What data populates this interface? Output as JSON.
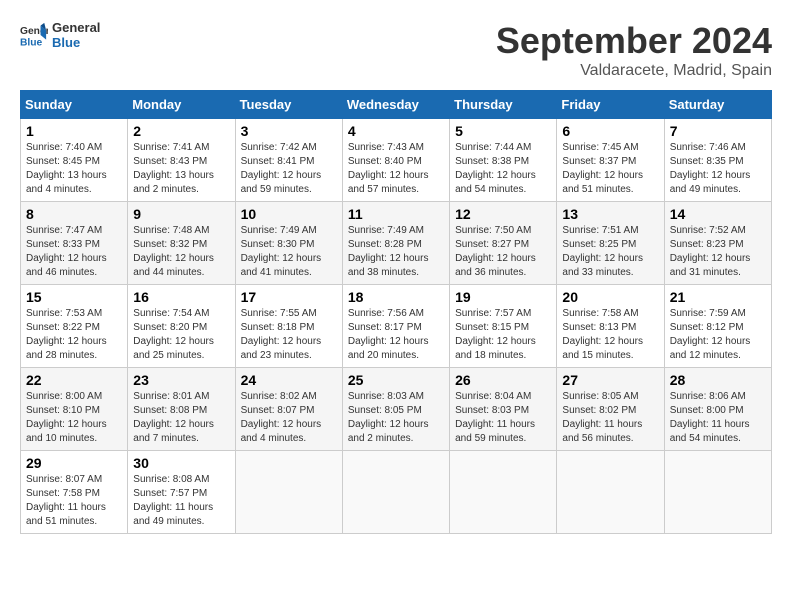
{
  "header": {
    "logo_text_general": "General",
    "logo_text_blue": "Blue",
    "title": "September 2024",
    "subtitle": "Valdaracete, Madrid, Spain"
  },
  "calendar": {
    "days_of_week": [
      "Sunday",
      "Monday",
      "Tuesday",
      "Wednesday",
      "Thursday",
      "Friday",
      "Saturday"
    ],
    "weeks": [
      [
        {
          "day": "",
          "info": ""
        },
        {
          "day": "",
          "info": ""
        },
        {
          "day": "",
          "info": ""
        },
        {
          "day": "",
          "info": ""
        },
        {
          "day": "5",
          "info": "Sunrise: 7:44 AM\nSunset: 8:38 PM\nDaylight: 12 hours and 54 minutes."
        },
        {
          "day": "6",
          "info": "Sunrise: 7:45 AM\nSunset: 8:37 PM\nDaylight: 12 hours and 51 minutes."
        },
        {
          "day": "7",
          "info": "Sunrise: 7:46 AM\nSunset: 8:35 PM\nDaylight: 12 hours and 49 minutes."
        }
      ],
      [
        {
          "day": "1",
          "info": "Sunrise: 7:40 AM\nSunset: 8:45 PM\nDaylight: 13 hours and 4 minutes."
        },
        {
          "day": "2",
          "info": "Sunrise: 7:41 AM\nSunset: 8:43 PM\nDaylight: 13 hours and 2 minutes."
        },
        {
          "day": "3",
          "info": "Sunrise: 7:42 AM\nSunset: 8:41 PM\nDaylight: 12 hours and 59 minutes."
        },
        {
          "day": "4",
          "info": "Sunrise: 7:43 AM\nSunset: 8:40 PM\nDaylight: 12 hours and 57 minutes."
        },
        {
          "day": "5",
          "info": "Sunrise: 7:44 AM\nSunset: 8:38 PM\nDaylight: 12 hours and 54 minutes."
        },
        {
          "day": "6",
          "info": "Sunrise: 7:45 AM\nSunset: 8:37 PM\nDaylight: 12 hours and 51 minutes."
        },
        {
          "day": "7",
          "info": "Sunrise: 7:46 AM\nSunset: 8:35 PM\nDaylight: 12 hours and 49 minutes."
        }
      ],
      [
        {
          "day": "8",
          "info": "Sunrise: 7:47 AM\nSunset: 8:33 PM\nDaylight: 12 hours and 46 minutes."
        },
        {
          "day": "9",
          "info": "Sunrise: 7:48 AM\nSunset: 8:32 PM\nDaylight: 12 hours and 44 minutes."
        },
        {
          "day": "10",
          "info": "Sunrise: 7:49 AM\nSunset: 8:30 PM\nDaylight: 12 hours and 41 minutes."
        },
        {
          "day": "11",
          "info": "Sunrise: 7:49 AM\nSunset: 8:28 PM\nDaylight: 12 hours and 38 minutes."
        },
        {
          "day": "12",
          "info": "Sunrise: 7:50 AM\nSunset: 8:27 PM\nDaylight: 12 hours and 36 minutes."
        },
        {
          "day": "13",
          "info": "Sunrise: 7:51 AM\nSunset: 8:25 PM\nDaylight: 12 hours and 33 minutes."
        },
        {
          "day": "14",
          "info": "Sunrise: 7:52 AM\nSunset: 8:23 PM\nDaylight: 12 hours and 31 minutes."
        }
      ],
      [
        {
          "day": "15",
          "info": "Sunrise: 7:53 AM\nSunset: 8:22 PM\nDaylight: 12 hours and 28 minutes."
        },
        {
          "day": "16",
          "info": "Sunrise: 7:54 AM\nSunset: 8:20 PM\nDaylight: 12 hours and 25 minutes."
        },
        {
          "day": "17",
          "info": "Sunrise: 7:55 AM\nSunset: 8:18 PM\nDaylight: 12 hours and 23 minutes."
        },
        {
          "day": "18",
          "info": "Sunrise: 7:56 AM\nSunset: 8:17 PM\nDaylight: 12 hours and 20 minutes."
        },
        {
          "day": "19",
          "info": "Sunrise: 7:57 AM\nSunset: 8:15 PM\nDaylight: 12 hours and 18 minutes."
        },
        {
          "day": "20",
          "info": "Sunrise: 7:58 AM\nSunset: 8:13 PM\nDaylight: 12 hours and 15 minutes."
        },
        {
          "day": "21",
          "info": "Sunrise: 7:59 AM\nSunset: 8:12 PM\nDaylight: 12 hours and 12 minutes."
        }
      ],
      [
        {
          "day": "22",
          "info": "Sunrise: 8:00 AM\nSunset: 8:10 PM\nDaylight: 12 hours and 10 minutes."
        },
        {
          "day": "23",
          "info": "Sunrise: 8:01 AM\nSunset: 8:08 PM\nDaylight: 12 hours and 7 minutes."
        },
        {
          "day": "24",
          "info": "Sunrise: 8:02 AM\nSunset: 8:07 PM\nDaylight: 12 hours and 4 minutes."
        },
        {
          "day": "25",
          "info": "Sunrise: 8:03 AM\nSunset: 8:05 PM\nDaylight: 12 hours and 2 minutes."
        },
        {
          "day": "26",
          "info": "Sunrise: 8:04 AM\nSunset: 8:03 PM\nDaylight: 11 hours and 59 minutes."
        },
        {
          "day": "27",
          "info": "Sunrise: 8:05 AM\nSunset: 8:02 PM\nDaylight: 11 hours and 56 minutes."
        },
        {
          "day": "28",
          "info": "Sunrise: 8:06 AM\nSunset: 8:00 PM\nDaylight: 11 hours and 54 minutes."
        }
      ],
      [
        {
          "day": "29",
          "info": "Sunrise: 8:07 AM\nSunset: 7:58 PM\nDaylight: 11 hours and 51 minutes."
        },
        {
          "day": "30",
          "info": "Sunrise: 8:08 AM\nSunset: 7:57 PM\nDaylight: 11 hours and 49 minutes."
        },
        {
          "day": "",
          "info": ""
        },
        {
          "day": "",
          "info": ""
        },
        {
          "day": "",
          "info": ""
        },
        {
          "day": "",
          "info": ""
        },
        {
          "day": "",
          "info": ""
        }
      ]
    ]
  }
}
